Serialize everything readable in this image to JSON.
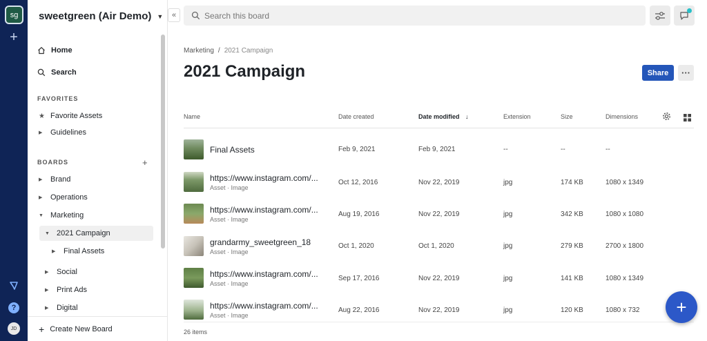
{
  "rail": {
    "workspace_initials": "sg",
    "user_initials": "JD",
    "help_label": "?"
  },
  "sidebar": {
    "workspace_name": "sweetgreen (Air Demo)",
    "home_label": "Home",
    "search_label": "Search",
    "favorites_heading": "FAVORITES",
    "favorites": [
      {
        "label": "Favorite Assets",
        "icon": "star-icon"
      },
      {
        "label": "Guidelines",
        "icon": "caret-right-icon"
      }
    ],
    "boards_heading": "BOARDS",
    "boards": [
      {
        "label": "Brand"
      },
      {
        "label": "Operations"
      },
      {
        "label": "Marketing"
      },
      {
        "label": "2021 Campaign"
      },
      {
        "label": "Final Assets"
      },
      {
        "label": "Social"
      },
      {
        "label": "Print Ads"
      },
      {
        "label": "Digital"
      }
    ],
    "create_board_label": "Create New Board"
  },
  "topbar": {
    "search_placeholder": "Search this board"
  },
  "header": {
    "breadcrumb_parent": "Marketing",
    "breadcrumb_sep": "/",
    "breadcrumb_current": "2021 Campaign",
    "title": "2021 Campaign",
    "share_label": "Share",
    "more_label": "···"
  },
  "table": {
    "columns": {
      "name": "Name",
      "created": "Date created",
      "modified": "Date modified",
      "sort_arrow": "↓",
      "extension": "Extension",
      "size": "Size",
      "dimensions": "Dimensions"
    },
    "rows": [
      {
        "name": "Final Assets",
        "meta": "",
        "created": "Feb 9, 2021",
        "modified": "Feb 9, 2021",
        "extension": "--",
        "size": "--",
        "dimensions": "--"
      },
      {
        "name": "https://www.instagram.com/...",
        "meta": "Asset · Image",
        "created": "Oct 12, 2016",
        "modified": "Nov 22, 2019",
        "extension": "jpg",
        "size": "174 KB",
        "dimensions": "1080 x 1349"
      },
      {
        "name": "https://www.instagram.com/...",
        "meta": "Asset · Image",
        "created": "Aug 19, 2016",
        "modified": "Nov 22, 2019",
        "extension": "jpg",
        "size": "342 KB",
        "dimensions": "1080 x 1080"
      },
      {
        "name": "grandarmy_sweetgreen_18",
        "meta": "Asset · Image",
        "created": "Oct 1, 2020",
        "modified": "Oct 1, 2020",
        "extension": "jpg",
        "size": "279 KB",
        "dimensions": "2700 x 1800"
      },
      {
        "name": "https://www.instagram.com/...",
        "meta": "Asset · Image",
        "created": "Sep 17, 2016",
        "modified": "Nov 22, 2019",
        "extension": "jpg",
        "size": "141 KB",
        "dimensions": "1080 x 1349"
      },
      {
        "name": "https://www.instagram.com/...",
        "meta": "Asset · Image",
        "created": "Aug 22, 2016",
        "modified": "Nov 22, 2019",
        "extension": "jpg",
        "size": "120 KB",
        "dimensions": "1080 x 732"
      }
    ],
    "item_count": "26 items"
  },
  "fab_label": "+",
  "colors": {
    "rail": "#0f2456",
    "accent": "#2456b9",
    "fab": "#2c58c8",
    "notification": "#28c0c8"
  }
}
